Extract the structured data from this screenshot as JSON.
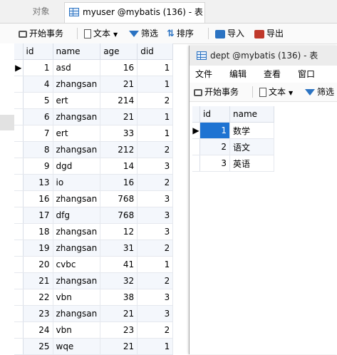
{
  "tabs": {
    "objects_label": "对象",
    "active_label": "myuser @mybatis (136) - 表"
  },
  "toolbar": {
    "begin_txn": "开始事务",
    "text": "文本",
    "filter": "筛选",
    "sort": "排序",
    "import": "导入",
    "export": "导出"
  },
  "myuser": {
    "columns": [
      "id",
      "name",
      "age",
      "did"
    ],
    "rows": [
      [
        "1",
        "asd",
        "16",
        "1"
      ],
      [
        "4",
        "zhangsan",
        "21",
        "1"
      ],
      [
        "5",
        "ert",
        "214",
        "2"
      ],
      [
        "6",
        "zhangsan",
        "21",
        "1"
      ],
      [
        "7",
        "ert",
        "33",
        "1"
      ],
      [
        "8",
        "zhangsan",
        "212",
        "2"
      ],
      [
        "9",
        "dgd",
        "14",
        "3"
      ],
      [
        "13",
        "io",
        "16",
        "2"
      ],
      [
        "16",
        "zhangsan",
        "768",
        "3"
      ],
      [
        "17",
        "dfg",
        "768",
        "3"
      ],
      [
        "18",
        "zhangsan",
        "12",
        "3"
      ],
      [
        "19",
        "zhangsan",
        "31",
        "2"
      ],
      [
        "20",
        "cvbc",
        "41",
        "1"
      ],
      [
        "21",
        "zhangsan",
        "32",
        "2"
      ],
      [
        "22",
        "vbn",
        "38",
        "3"
      ],
      [
        "23",
        "zhangsan",
        "21",
        "3"
      ],
      [
        "24",
        "vbn",
        "23",
        "2"
      ],
      [
        "25",
        "wqe",
        "21",
        "1"
      ]
    ]
  },
  "dept": {
    "title": "dept @mybatis (136) - 表",
    "menu": [
      "文件",
      "编辑",
      "查看",
      "窗口"
    ],
    "begin_txn": "开始事务",
    "text": "文本",
    "filter": "筛选",
    "columns": [
      "id",
      "name"
    ],
    "rows": [
      [
        "1",
        "数学"
      ],
      [
        "2",
        "语文"
      ],
      [
        "3",
        "英语"
      ]
    ]
  }
}
